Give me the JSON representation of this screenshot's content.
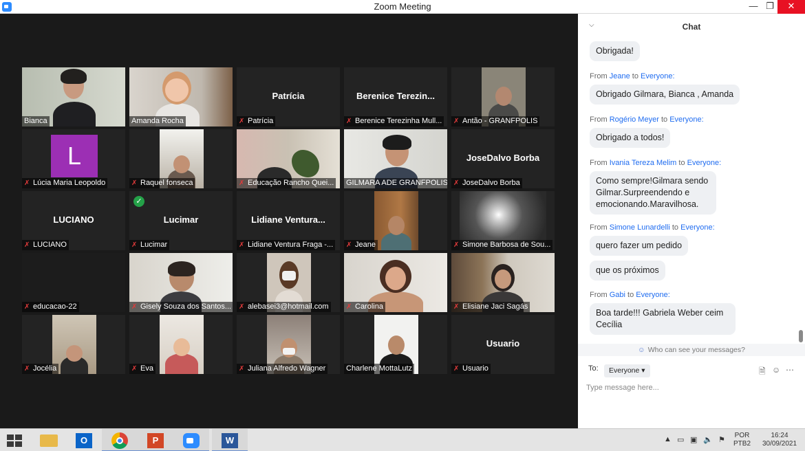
{
  "window": {
    "title": "Zoom Meeting",
    "minimize": "—",
    "maximize": "❐",
    "close": "✕"
  },
  "participants": [
    {
      "name": "Bianca",
      "type": "video",
      "active": true,
      "muted": false
    },
    {
      "name": "Amanda Rocha",
      "type": "video",
      "muted": false
    },
    {
      "name": "Patrícia",
      "display": "Patrícia",
      "type": "name",
      "muted": true
    },
    {
      "name": "Berenice Terezinha Mull...",
      "display": "Berenice Terezin...",
      "type": "name",
      "muted": true
    },
    {
      "name": "Antão  - GRANFPOLIS",
      "type": "video",
      "muted": true
    },
    {
      "name": "Lúcia Maria Leopoldo",
      "initial": "L",
      "type": "initial",
      "muted": true
    },
    {
      "name": "Raquel fonseca",
      "type": "video",
      "muted": true
    },
    {
      "name": "Educação Rancho Quei...",
      "type": "video",
      "muted": true
    },
    {
      "name": "GILMARA ADE GRANFPOLIS",
      "type": "video",
      "muted": false
    },
    {
      "name": "JoseDalvo Borba",
      "display": "JoseDalvo Borba",
      "type": "name",
      "muted": true
    },
    {
      "name": "LUCIANO",
      "display": "LUCIANO",
      "type": "name",
      "muted": true
    },
    {
      "name": "Lucimar",
      "display": "Lucimar",
      "type": "name",
      "muted": true,
      "verified": true
    },
    {
      "name": "Lidiane Ventura  Fraga -...",
      "display": "Lidiane  Ventura...",
      "type": "name",
      "muted": true
    },
    {
      "name": "Jeane",
      "type": "video",
      "muted": true
    },
    {
      "name": "Simone Barbosa de Sou...",
      "type": "video",
      "muted": true
    },
    {
      "name": "educacao-22",
      "type": "blank",
      "muted": true
    },
    {
      "name": "Gisely Souza dos Santos...",
      "type": "video",
      "muted": true
    },
    {
      "name": "alebasei3@hotmail.com",
      "type": "video",
      "muted": true
    },
    {
      "name": "Carolina",
      "type": "video",
      "muted": true
    },
    {
      "name": "Elisiane Jaci Sagás",
      "type": "video",
      "muted": true
    },
    {
      "name": "Jocélia",
      "type": "video",
      "muted": true
    },
    {
      "name": "Eva",
      "type": "video",
      "muted": true
    },
    {
      "name": "Juliana Alfredo Wagner",
      "type": "video",
      "muted": true
    },
    {
      "name": "Charlene MottaLutz",
      "type": "video",
      "muted": false
    },
    {
      "name": "Usuario",
      "display": "Usuario",
      "type": "name",
      "muted": true
    }
  ],
  "chat": {
    "title": "Chat",
    "from_word": "From",
    "to_word": "to",
    "everyone": "Everyone:",
    "messages": [
      {
        "text": "Obrigada!"
      },
      {
        "from": "Jeane",
        "text": "Obrigado Gilmara, Bianca , Amanda"
      },
      {
        "from": "Rogério Meyer",
        "text": "Obrigado a todos!"
      },
      {
        "from": "Ivania Tereza Melim",
        "text": "Como sempre!Gilmara sendo Gilmar.Surpreendendo e emocionando.Maravilhosa."
      },
      {
        "from": "Simone Lunardelli",
        "text": "quero fazer um pedido"
      },
      {
        "text": "que os próximos"
      },
      {
        "from": "Gabi",
        "text": "Boa tarde!!! Gabriela  Weber ceim Cecília"
      }
    ],
    "who_can_see": "Who can see your messages?",
    "to_label": "To:",
    "to_value": "Everyone",
    "input_placeholder": "Type message here..."
  },
  "taskbar": {
    "apps": [
      "file-explorer",
      "outlook",
      "chrome",
      "powerpoint",
      "zoom",
      "word"
    ],
    "lang_top": "POR",
    "lang_bottom": "PTB2",
    "time": "16:24",
    "date": "30/09/2021"
  }
}
